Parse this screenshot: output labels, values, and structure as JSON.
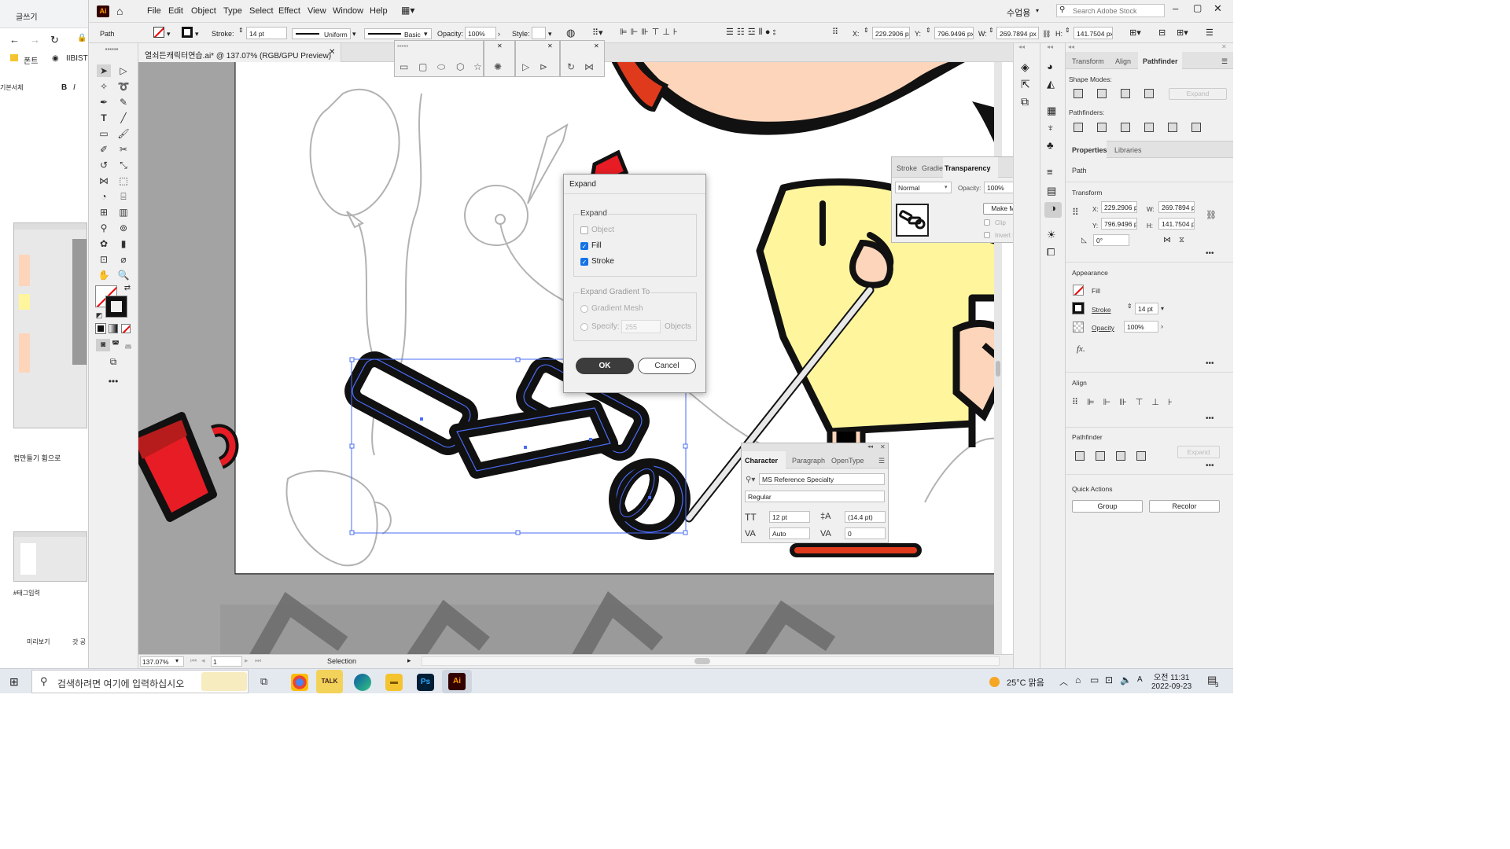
{
  "browser": {
    "tab_title": "글쓰기",
    "bookmark_1": "폰트",
    "bookmark_2": "IIBISTE",
    "editor_font": "기본서체",
    "bold": "B",
    "italic": "I",
    "caption_1": "컵만들기 휨으로",
    "caption_2": "#태그입력",
    "preview_btn": "미리보기",
    "more_btn": "갓 공"
  },
  "app": {
    "logo": "Ai",
    "menus": [
      "File",
      "Edit",
      "Object",
      "Type",
      "Select",
      "Effect",
      "View",
      "Window",
      "Help"
    ],
    "workspace": "수업용",
    "search_placeholder": "Search Adobe Stock"
  },
  "control": {
    "selection_type": "Path",
    "stroke_label": "Stroke:",
    "stroke_value": "14 pt",
    "profile": "Uniform",
    "brush": "Basic",
    "opacity_label": "Opacity:",
    "opacity_value": "100%",
    "style_label": "Style:",
    "x_label": "X:",
    "x_value": "229.2906 px",
    "y_label": "Y:",
    "y_value": "796.9496 px",
    "w_label": "W:",
    "w_value": "269.7894 px",
    "h_label": "H:",
    "h_value": "141.7504 px"
  },
  "document": {
    "tab_title": "열쇠든캐릭터연습.ai* @ 137.07% (RGB/GPU Preview)",
    "zoom": "137.07%",
    "artboard": "1",
    "status_tool": "Selection"
  },
  "dialog": {
    "title": "Expand",
    "group_expand": "Expand",
    "object": "Object",
    "fill": "Fill",
    "stroke": "Stroke",
    "group_gradient": "Expand Gradient To",
    "gradient_mesh": "Gradient Mesh",
    "specify": "Specify:",
    "specify_value": "255",
    "objects": "Objects",
    "ok": "OK",
    "cancel": "Cancel",
    "object_checked": false,
    "fill_checked": true,
    "stroke_checked": true
  },
  "transparency_panel": {
    "tabs": [
      "Stroke",
      "Gradie",
      "Transparency"
    ],
    "mode": "Normal",
    "opacity_label": "Opacity:",
    "opacity_value": "100%",
    "make_mask": "Make Mask",
    "clip": "Clip",
    "invert_mask": "Invert Mask"
  },
  "character_panel": {
    "tabs": [
      "Character",
      "Paragraph",
      "OpenType"
    ],
    "font": "MS Reference Specialty",
    "style": "Regular",
    "size": "12 pt",
    "leading": "(14.4 pt)",
    "kerning": "Auto",
    "tracking": "0"
  },
  "pathfinder_panel": {
    "tabs": [
      "Transform",
      "Align",
      "Pathfinder"
    ],
    "shape_modes": "Shape Modes:",
    "pathfinders": "Pathfinders:",
    "expand": "Expand"
  },
  "properties_panel": {
    "tabs": [
      "Properties",
      "Libraries"
    ],
    "selection": "Path",
    "transform": "Transform",
    "x_label": "X:",
    "x_value": "229.2906 p",
    "y_label": "Y:",
    "y_value": "796.9496 p",
    "w_label": "W:",
    "w_value": "269.7894 p",
    "h_label": "H:",
    "h_value": "141.7504 p",
    "angle": "0°",
    "appearance": "Appearance",
    "fill": "Fill",
    "stroke": "Stroke",
    "stroke_value": "14 pt",
    "opacity": "Opacity",
    "opacity_value": "100%",
    "fx": "fx.",
    "align": "Align",
    "pathfinder": "Pathfinder",
    "pathfinder_expand": "Expand",
    "quick_actions": "Quick Actions",
    "group_btn": "Group",
    "recolor_btn": "Recolor"
  },
  "taskbar": {
    "search_placeholder": "검색하려면 여기에 입력하십시오",
    "weather": "25°C 맑음",
    "time": "오전 11:31",
    "date": "2022-09-23",
    "notifications": "3"
  },
  "colors": {
    "ai_orange": "#ff9a00",
    "ai_bg": "#330000",
    "selection_blue": "#4a6cf7",
    "button_dark": "#3c3c3c",
    "cup_red": "#e81c24",
    "skin": "#fcd5bb",
    "shirt_yellow": "#fff59d"
  }
}
